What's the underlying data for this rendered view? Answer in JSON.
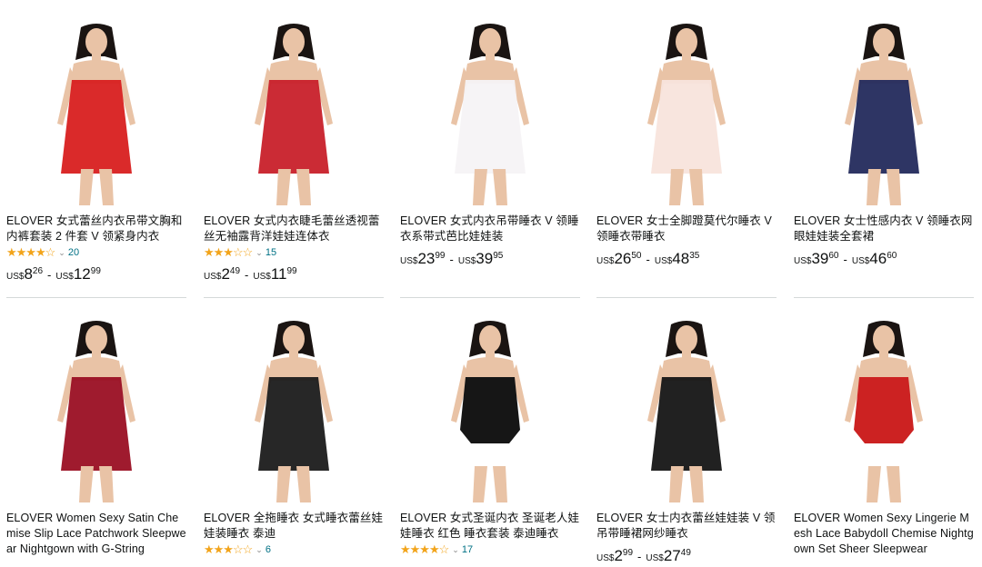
{
  "products": [
    {
      "title": "ELOVER 女式蕾丝内衣吊带文胸和内裤套装 2 件套 V 领紧身内衣",
      "stars": "★★★★☆",
      "rating_count": "20",
      "price": {
        "low_cur": "US$",
        "low_whole": "8",
        "low_frac": "26",
        "high_cur": "US$",
        "high_whole": "12",
        "high_frac": "99"
      },
      "color": "#d81f1f"
    },
    {
      "title": "ELOVER 女式内衣睫毛蕾丝透视蕾丝无袖露背洋娃娃连体衣",
      "stars": "★★★☆☆",
      "rating_count": "15",
      "price": {
        "low_cur": "US$",
        "low_whole": "2",
        "low_frac": "49",
        "high_cur": "US$",
        "high_whole": "11",
        "high_frac": "99"
      },
      "color": "#c8202a"
    },
    {
      "title": "ELOVER 女式内衣吊带睡衣 V 领睡衣系带式芭比娃娃装",
      "stars": "",
      "rating_count": "",
      "price": {
        "low_cur": "US$",
        "low_whole": "23",
        "low_frac": "99",
        "high_cur": "US$",
        "high_whole": "39",
        "high_frac": "95"
      },
      "color": "#f6f3f6"
    },
    {
      "title": "ELOVER 女士全脚蹬莫代尔睡衣 V 领睡衣带睡衣",
      "stars": "",
      "rating_count": "",
      "price": {
        "low_cur": "US$",
        "low_whole": "26",
        "low_frac": "50",
        "high_cur": "US$",
        "high_whole": "48",
        "high_frac": "35"
      },
      "color": "#f8e4dc"
    },
    {
      "title": "ELOVER 女士性感内衣 V 领睡衣网眼娃娃装全套裙",
      "stars": "",
      "rating_count": "",
      "price": {
        "low_cur": "US$",
        "low_whole": "39",
        "low_frac": "60",
        "high_cur": "US$",
        "high_whole": "46",
        "high_frac": "60"
      },
      "color": "#232a5c"
    },
    {
      "title": "ELOVER Women Sexy Satin Chemise Slip Lace Patchwork Sleepwear Nightgown with G-String",
      "stars": "",
      "rating_count": "",
      "price": null,
      "color": "#9a0f23"
    },
    {
      "title": "ELOVER 全拖睡衣 女式睡衣蕾丝娃娃装睡衣 泰迪",
      "stars": "★★★☆☆",
      "rating_count": "6",
      "price": null,
      "color": "#1b1b1b"
    },
    {
      "title": "ELOVER 女式圣诞内衣 圣诞老人娃娃睡衣 红色 睡衣套装 泰迪睡衣",
      "stars": "★★★★☆",
      "rating_count": "17",
      "price": null,
      "color": "#161616"
    },
    {
      "title": "ELOVER 女士内衣蕾丝娃娃装 V 领吊带睡裙网纱睡衣",
      "stars": "",
      "rating_count": "",
      "price": {
        "low_cur": "US$",
        "low_whole": "2",
        "low_frac": "99",
        "high_cur": "US$",
        "high_whole": "27",
        "high_frac": "49"
      },
      "color": "#151515"
    },
    {
      "title": "ELOVER Women Sexy Lingerie Mesh Lace Babydoll Chemise Nightgown Set Sheer Sleepwear",
      "stars": "",
      "rating_count": "",
      "price": null,
      "color": "#cc2222"
    }
  ]
}
